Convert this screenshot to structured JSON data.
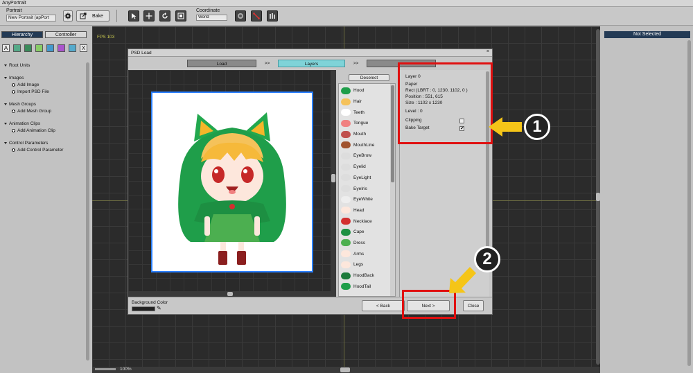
{
  "app_title": "AnyPortrait",
  "toolbar": {
    "portrait_label": "Portrait",
    "portrait_value": "New Portrait (apPort",
    "bake_label": "Bake",
    "coordinate_label": "Coordinate",
    "coordinate_value": "World"
  },
  "left_panel": {
    "tabs": [
      "Hierarchy",
      "Controller"
    ],
    "icon_a": "A",
    "icon_x": "X",
    "tree": [
      {
        "kind": "group",
        "label": "Root Units"
      },
      {
        "kind": "group",
        "label": "Images"
      },
      {
        "kind": "add",
        "label": "Add Image"
      },
      {
        "kind": "add",
        "label": "Import PSD File"
      },
      {
        "kind": "group",
        "label": "Mesh Groups"
      },
      {
        "kind": "add",
        "label": "Add Mesh Group"
      },
      {
        "kind": "group",
        "label": "Animation Clips"
      },
      {
        "kind": "add",
        "label": "Add Animation Clip"
      },
      {
        "kind": "group",
        "label": "Control Parameters"
      },
      {
        "kind": "add",
        "label": "Add Control Parameter"
      }
    ]
  },
  "canvas": {
    "fps": "FPS 103",
    "zoom": "100%"
  },
  "right_panel": {
    "header": "Not Selected"
  },
  "dialog": {
    "title": "PSD Load",
    "steps": [
      "Load",
      ">>",
      "Layers",
      ">>",
      ""
    ],
    "deselect": "Deselect",
    "layers": [
      "Hood",
      "Hair",
      "Teeth",
      "Tongue",
      "Mouth",
      "MouthLine",
      "EyeBrow",
      "Eyelid",
      "EyeLight",
      "EyeIris",
      "EyeWhite",
      "Head",
      "Necklace",
      "Cape",
      "Dress",
      "Arms",
      "Legs",
      "HoodBack",
      "HoodTail"
    ],
    "info": {
      "name": "Layer 0",
      "type": "Paper",
      "rect": "Rect (LBRT : 0, 1230, 1102, 0 )",
      "position": "Position : 551, 615",
      "size": "Size : 1102 x 1230",
      "level": "Level : 0",
      "clipping_label": "Clipping",
      "bake_target_label": "Bake Target",
      "bake_target_check": "✔"
    },
    "bg_color_label": "Background Color",
    "back": "< Back",
    "next": "Next >",
    "close": "Close"
  },
  "badges": [
    "1",
    "2"
  ],
  "colors": {
    "accent": "#e01010",
    "arrow": "#f5c518",
    "step_active": "#7fd3d8",
    "hierarchy_tab": "#233a55"
  }
}
